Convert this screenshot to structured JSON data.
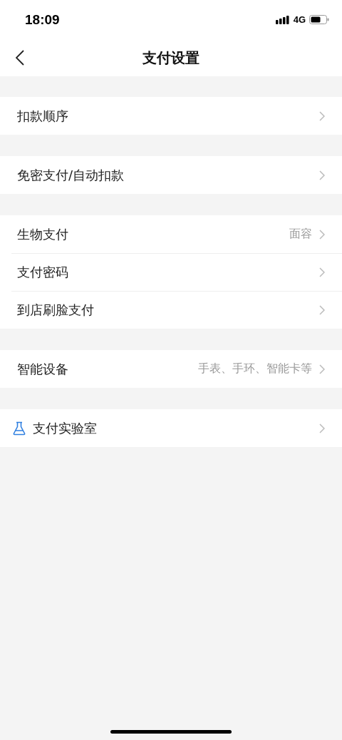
{
  "status_bar": {
    "time": "18:09",
    "network": "4G"
  },
  "header": {
    "title": "支付设置"
  },
  "groups": [
    {
      "items": [
        {
          "kind": "plain",
          "label": "扣款顺序"
        }
      ]
    },
    {
      "items": [
        {
          "kind": "plain",
          "label": "免密支付/自动扣款"
        }
      ]
    },
    {
      "items": [
        {
          "kind": "plain",
          "label": "生物支付",
          "value": "面容"
        },
        {
          "kind": "plain",
          "label": "支付密码"
        },
        {
          "kind": "plain",
          "label": "到店刷脸支付"
        }
      ]
    },
    {
      "items": [
        {
          "kind": "plain",
          "label": "智能设备",
          "value": "手表、手环、智能卡等"
        }
      ]
    },
    {
      "items": [
        {
          "kind": "lab",
          "label": "支付实验室"
        }
      ]
    }
  ]
}
